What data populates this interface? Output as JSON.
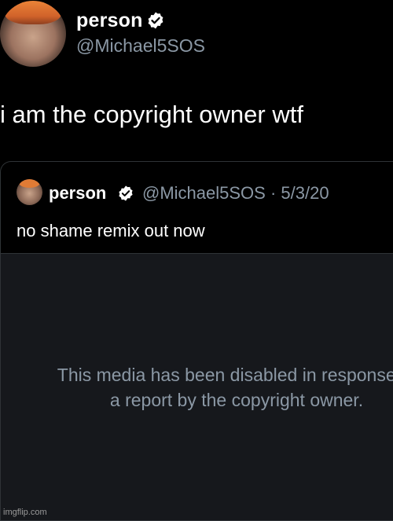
{
  "tweet": {
    "name": "person",
    "handle": "@Michael5SOS",
    "text": "i am the copyright owner wtf"
  },
  "quoted": {
    "name": "person",
    "handle_date": "@Michael5SOS · 5/3/20",
    "text": "no shame remix out now",
    "media_notice_line1": "This media has been disabled in response to",
    "media_notice_line2": "a report by the copyright owner."
  },
  "icons": {
    "verified": "verified-badge-icon"
  },
  "colors": {
    "background": "#000000",
    "secondary_text": "#8b98a5",
    "media_bg": "#16181c",
    "border": "#2f3336"
  },
  "watermark": "imgflip.com"
}
